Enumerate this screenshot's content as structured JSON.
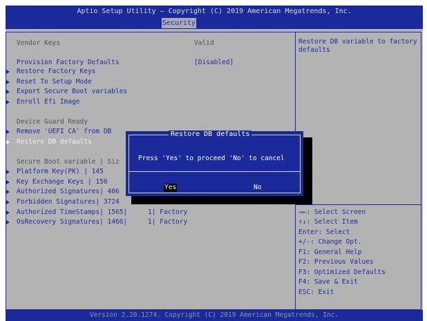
{
  "header": {
    "title": "Aptio Setup Utility – Copyright (C) 2019 American Megatrends, Inc.",
    "active_tab": "Security"
  },
  "main": {
    "vendor_keys": {
      "label": "Vendor Keys",
      "value": "Valid"
    },
    "provision": {
      "label": "Provision Factory Defaults",
      "value": "[Disabled]"
    },
    "menu_items": [
      {
        "label": "Restore Factory Keys"
      },
      {
        "label": "Reset To Setup Mode"
      },
      {
        "label": "Export Secure Boot variables"
      },
      {
        "label": "Enroll Efi Image"
      }
    ],
    "device_guard": {
      "label": "Device Guard Ready"
    },
    "guard_items": [
      {
        "label": "Remove 'UEFI CA' from DB"
      },
      {
        "label": "Restore DB defaults"
      }
    ],
    "variables": {
      "header": "Secure Boot variable | Siz",
      "rows": [
        {
          "label": "Platform Key(PK)      | 145"
        },
        {
          "label": "Key Exchange Keys     | 156"
        },
        {
          "label": "Authorized Signatures| 406"
        },
        {
          "label": "Forbidden  Signatures| 3724"
        },
        {
          "label": "Authorized TimeStamps| 1565|",
          "count": "1| Factory"
        },
        {
          "label": "OsRecovery Signatures| 1466|",
          "count": "1| Factory"
        }
      ]
    }
  },
  "help": {
    "description": "Restore DB variable to factory defaults",
    "keys": [
      "→←: Select Screen",
      "↑↓: Select Item",
      "Enter: Select",
      "+/-: Change Opt.",
      "F1: General Help",
      "F2: Previous Values",
      "F3: Optimized Defaults",
      "F4: Save & Exit",
      "ESC: Exit"
    ]
  },
  "dialog": {
    "title": "Restore DB defaults",
    "message": "Press 'Yes' to proceed 'No' to cancel",
    "yes_label": "Yes",
    "no_label": "No"
  },
  "footer": {
    "version": "Version 2.20.1274. Copyright (C) 2019 American Megatrends, Inc."
  },
  "colors": {
    "bar_blue": "#1b2a9a",
    "panel_gray": "#b3b3b3",
    "item_blue": "#1c2ca2"
  }
}
